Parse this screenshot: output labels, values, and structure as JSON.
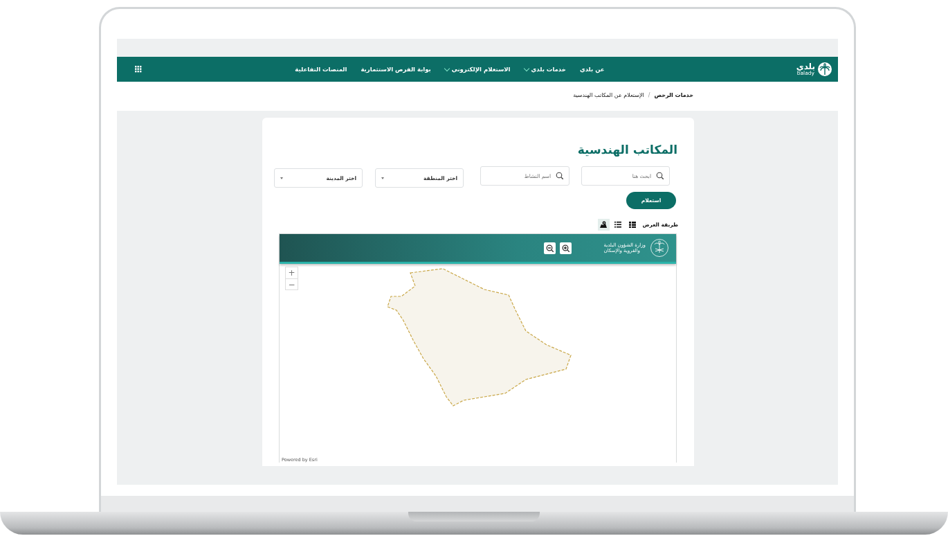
{
  "logo": {
    "name": "بلدي",
    "subtitle": "balady"
  },
  "nav": {
    "items": [
      {
        "label": "عن بلدي",
        "dropdown": false
      },
      {
        "label": "خدمات بلدي",
        "dropdown": true
      },
      {
        "label": "الاستعلام الإلكتروني",
        "dropdown": true
      },
      {
        "label": "بوابة الفرص الاستثمارية",
        "dropdown": false
      },
      {
        "label": "المنصات التفاعلية",
        "dropdown": false
      }
    ]
  },
  "breadcrumb": {
    "separator": "/",
    "items": [
      {
        "label": "خدمات الرخص",
        "current": false
      },
      {
        "label": "الإستعلام عن المكاتب الهندسية",
        "current": true
      }
    ]
  },
  "page": {
    "title": "المكاتب الهندسية",
    "filters": [
      {
        "kind": "search",
        "placeholder": "ابحث هنا"
      },
      {
        "kind": "search",
        "placeholder": "اسم النشاط"
      },
      {
        "kind": "select",
        "value": "اختر المنطقة"
      },
      {
        "kind": "select",
        "value": "اختر المدينة"
      }
    ],
    "submit": "استعلام",
    "view_mode": {
      "label": "طريقة العرض",
      "options": [
        {
          "kind": "grid",
          "selected": false
        },
        {
          "kind": "list",
          "selected": false
        },
        {
          "kind": "map",
          "selected": true
        }
      ]
    }
  },
  "map": {
    "ministry": [
      "وزارة الشؤون البلدية",
      "والقروية والإسكان"
    ],
    "zoom_controls": [
      "+",
      "−"
    ],
    "attribution": "Powered by Esri"
  }
}
